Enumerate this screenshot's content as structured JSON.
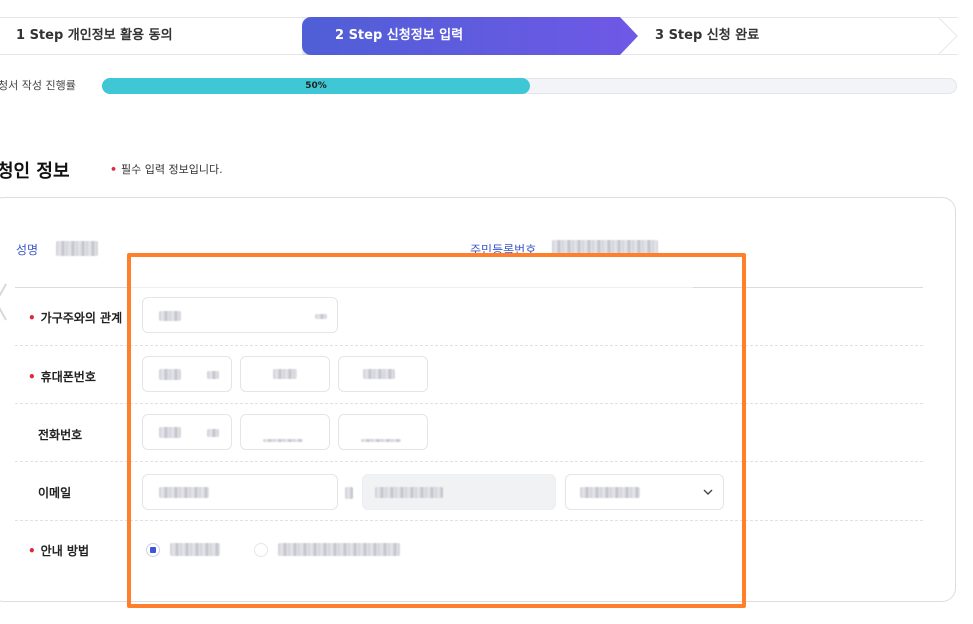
{
  "steps": {
    "step1": "1 Step 개인정보 활용 동의",
    "step2": "2 Step 신청정보 입력",
    "step3": "3 Step 신청 완료",
    "active_index": 2
  },
  "progress": {
    "label": "청서 작성 진행률",
    "value_text": "50%",
    "value": 0.5,
    "color": "#3fc7d6"
  },
  "section": {
    "title": "청인 정보",
    "required_note": "필수 입력 정보입니다."
  },
  "applicant": {
    "name_label": "성명",
    "rrn_label": "주민등록번호"
  },
  "form": {
    "relation_label": "가구주와의 관계",
    "mobile_label": "휴대폰번호",
    "phone_label": "전화번호",
    "email_label": "이메일",
    "notice_label": "안내 방법"
  },
  "colors": {
    "accent": "#4f5fd6",
    "required": "#e0283a",
    "highlight": "#ff7f2a"
  },
  "icons": {
    "select": "chevron-down-icon",
    "step_arrow": "chevron-right-icon"
  }
}
